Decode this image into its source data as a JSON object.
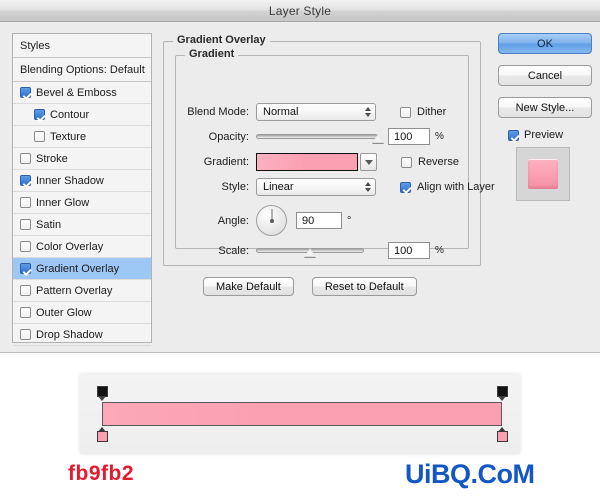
{
  "window": {
    "title": "Layer Style"
  },
  "sidebar": {
    "headers": [
      {
        "label": "Styles"
      },
      {
        "label": "Blending Options: Default"
      }
    ],
    "items": [
      {
        "label": "Bevel & Emboss",
        "checked": true,
        "indent": false,
        "selected": false
      },
      {
        "label": "Contour",
        "checked": true,
        "indent": true,
        "selected": false
      },
      {
        "label": "Texture",
        "checked": false,
        "indent": true,
        "selected": false
      },
      {
        "label": "Stroke",
        "checked": false,
        "indent": false,
        "selected": false
      },
      {
        "label": "Inner Shadow",
        "checked": true,
        "indent": false,
        "selected": false
      },
      {
        "label": "Inner Glow",
        "checked": false,
        "indent": false,
        "selected": false
      },
      {
        "label": "Satin",
        "checked": false,
        "indent": false,
        "selected": false
      },
      {
        "label": "Color Overlay",
        "checked": false,
        "indent": false,
        "selected": false
      },
      {
        "label": "Gradient Overlay",
        "checked": true,
        "indent": false,
        "selected": true
      },
      {
        "label": "Pattern Overlay",
        "checked": false,
        "indent": false,
        "selected": false
      },
      {
        "label": "Outer Glow",
        "checked": false,
        "indent": false,
        "selected": false
      },
      {
        "label": "Drop Shadow",
        "checked": false,
        "indent": false,
        "selected": false
      }
    ]
  },
  "panel": {
    "group_title": "Gradient Overlay",
    "subgroup_title": "Gradient",
    "blend_mode": {
      "label": "Blend Mode:",
      "value": "Normal"
    },
    "dither": {
      "label": "Dither",
      "checked": false
    },
    "opacity": {
      "label": "Opacity:",
      "value": "100",
      "unit": "%",
      "percent": 100
    },
    "gradient": {
      "label": "Gradient:",
      "color": "#fb9fb2"
    },
    "reverse": {
      "label": "Reverse",
      "checked": false
    },
    "style": {
      "label": "Style:",
      "value": "Linear"
    },
    "align_with_layer": {
      "label": "Align with Layer",
      "checked": true
    },
    "angle": {
      "label": "Angle:",
      "value": "90",
      "unit": "°",
      "degrees": 90
    },
    "scale": {
      "label": "Scale:",
      "value": "100",
      "unit": "%",
      "percent": 50
    },
    "make_default": "Make Default",
    "reset_to_default": "Reset to Default"
  },
  "actions": {
    "ok": "OK",
    "cancel": "Cancel",
    "new_style": "New Style...",
    "preview": {
      "label": "Preview",
      "checked": true
    }
  },
  "gradient_strip": {
    "color": "#fb9fb2",
    "opacity_stops": [
      {
        "position": 0
      },
      {
        "position": 100
      }
    ],
    "color_stops": [
      {
        "position": 0,
        "color": "#fb9fb2"
      },
      {
        "position": 100,
        "color": "#fb9fb2"
      }
    ]
  },
  "footer": {
    "hex_label": "fb9fb2",
    "watermark": "UiBQ.CoM"
  }
}
